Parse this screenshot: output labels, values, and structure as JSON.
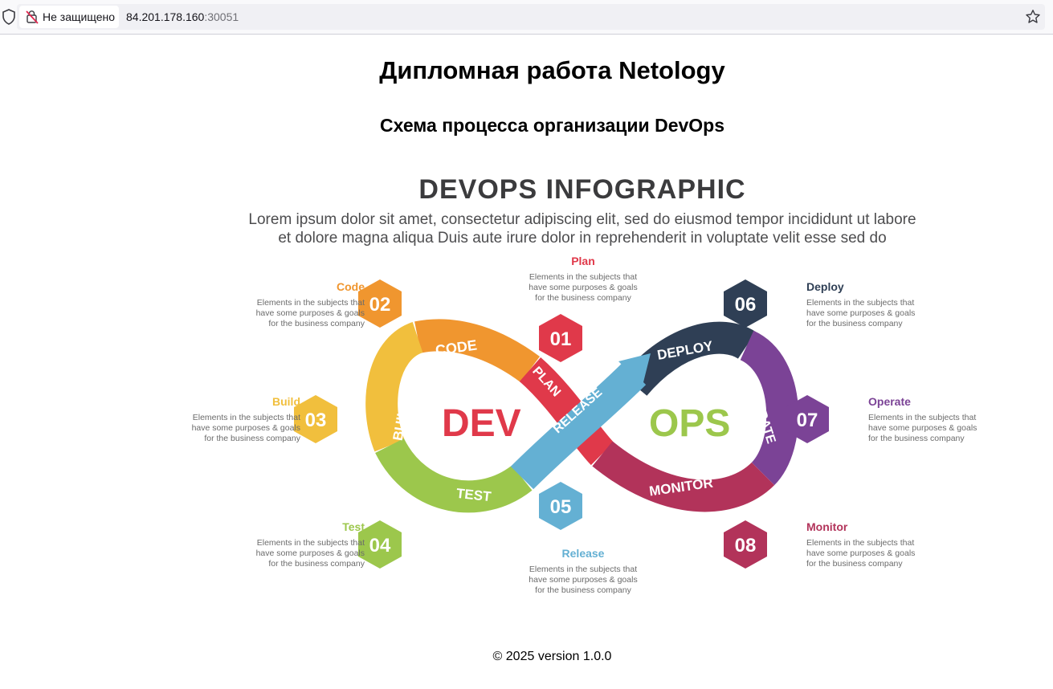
{
  "browser": {
    "security_label": "Не защищено",
    "url_host": "84.201.178.160",
    "url_port": ":30051"
  },
  "page": {
    "title": "Дипломная работа Netology",
    "subtitle": "Схема процесса организации DevOps",
    "footer": "© 2025 version 1.0.0"
  },
  "infographic": {
    "title": "DEVOPS INFOGRAPHIC",
    "subtitle_line1": "Lorem ipsum dolor sit amet, consectetur adipiscing elit, sed do eiusmod tempor incididunt ut labore",
    "subtitle_line2": "et dolore magna aliqua Duis aute irure dolor in reprehenderit in voluptate velit esse sed do",
    "dev_label": "DEV",
    "ops_label": "OPS",
    "loop_labels": {
      "code": "CODE",
      "plan": "PLAN",
      "build": "BUILD",
      "test": "TEST",
      "release": "RELEASE",
      "deploy": "DEPLOY",
      "operate": "OPERATE",
      "monitor": "MONITOR"
    },
    "desc_line1": "Elements in the subjects that",
    "desc_line2": "have  some purposes & goals",
    "desc_line3": "for the  business company",
    "steps": [
      {
        "num": "01",
        "name": "Plan",
        "color": "#e0394a"
      },
      {
        "num": "02",
        "name": "Code",
        "color": "#f0962f"
      },
      {
        "num": "03",
        "name": "Build",
        "color": "#f1bf3d"
      },
      {
        "num": "04",
        "name": "Test",
        "color": "#9cc74c"
      },
      {
        "num": "05",
        "name": "Release",
        "color": "#64b0d3"
      },
      {
        "num": "06",
        "name": "Deploy",
        "color": "#2f3f55"
      },
      {
        "num": "07",
        "name": "Operate",
        "color": "#7b4396"
      },
      {
        "num": "08",
        "name": "Monitor",
        "color": "#b2335a"
      }
    ]
  }
}
